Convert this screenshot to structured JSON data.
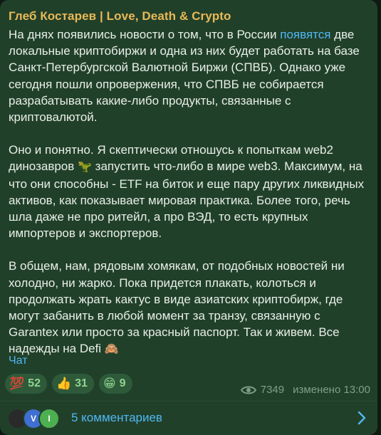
{
  "post": {
    "sender": "Глеб Костарев | Love, Death & Crypto",
    "p1_a": "На днях появились новости о том, что в России ",
    "p1_link": "появятся",
    "p1_b": " две локальные криптобиржи и одна из них будет работать на базе Санкт-Петербургской Валютной Биржи (СПВБ). Однако уже сегодня пошли опровержения, что СПВБ не собирается разрабатывать какие-либо продукты, связанные с криптовалютой.",
    "p2_a": "Оно и понятно. Я скептически отношусь к попыткам web2 динозавров ",
    "p2_emoji": "🦖",
    "p2_b": " запустить что-либо в мире web3. Максимум, на что они способны - ETF на биток и еще пару других ликвидных активов, как показывает мировая практика. Более того, речь шла даже не про ритейл, а про ВЭД, то есть крупных импортеров и экспортеров.",
    "p3_a": "В общем, нам, рядовым хомякам, от подобных новостей ни холодно, ни жарко. Пока придется плакать, колоться и продолжать жрать кактус в виде азиатских криптобирж, где могут забанить в любой момент за транзу, связанную с Garantex или просто за красный паспорт. Так и живем. Все надежды на Defi ",
    "p3_emoji": "🙈",
    "chat_link": "Чат"
  },
  "reactions": [
    {
      "emoji": "💯",
      "count": "52"
    },
    {
      "emoji": "👍",
      "count": "31"
    },
    {
      "emoji": "😁",
      "count": "9"
    }
  ],
  "meta": {
    "views": "7349",
    "edited": "изменено 13:00",
    "eye_icon": "eye-icon"
  },
  "comments": {
    "avatars": [
      {
        "initial": "",
        "color": "#2a2a2a"
      },
      {
        "initial": "V",
        "color": "#3e6fd1"
      },
      {
        "initial": "I",
        "color": "#4caf50"
      }
    ],
    "label": "5 комментариев",
    "chevron_icon": "chevron-right-icon"
  },
  "colors": {
    "bubble": "#21402a",
    "sender": "#e9b956",
    "link": "#4fb8f3",
    "text": "#e8efe7",
    "reaction_bg": "#2e5a3a",
    "reaction_text": "#8fd38f",
    "meta": "#7fa085"
  }
}
